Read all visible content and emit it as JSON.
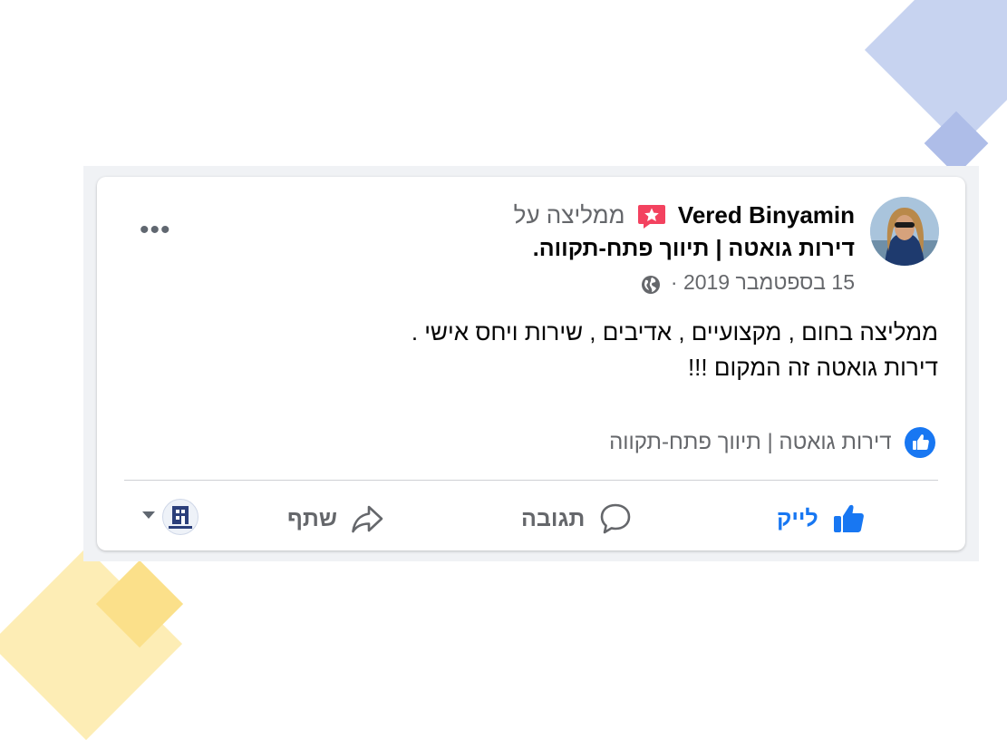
{
  "post": {
    "author": "Vered Binyamin",
    "recommends_text": "ממליצה על",
    "page_name": "דירות גואטה | תיווך פתח-תקווה",
    "page_name_suffix": ".",
    "date": "15 בספטמבר 2019 ·",
    "more_label": "•••",
    "body_line1": "ממליצה בחום , מקצועיים , אדיבים , שירות ויחס אישי .",
    "body_line2": "דירות גואטה זה המקום !!!",
    "liked_page": "דירות גואטה | תיווך פתח-תקווה"
  },
  "actions": {
    "like": "לייק",
    "comment": "תגובה",
    "share": "שתף"
  },
  "colors": {
    "accent": "#1877f2",
    "recommend_badge": "#f3425f",
    "secondary_text": "#65676b"
  },
  "icons": [
    "recommend-badge-icon",
    "globe-icon",
    "like-badge-icon",
    "thumbs-up-icon",
    "comment-icon",
    "share-icon",
    "caret-down-icon"
  ]
}
